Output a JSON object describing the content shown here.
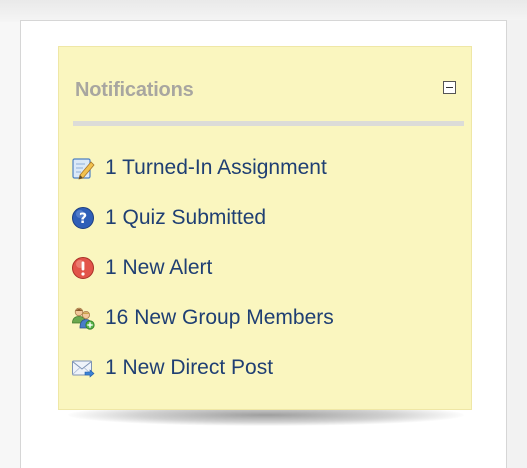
{
  "widget": {
    "title": "Notifications",
    "collapse_icon": "collapse-icon"
  },
  "notifications": [
    {
      "label": "1 Turned-In Assignment",
      "icon": "assignment-pencil-icon"
    },
    {
      "label": "1 Quiz Submitted",
      "icon": "quiz-question-icon"
    },
    {
      "label": "1 New Alert",
      "icon": "alert-icon"
    },
    {
      "label": "16 New Group Members",
      "icon": "group-members-icon"
    },
    {
      "label": "1 New Direct Post",
      "icon": "direct-post-envelope-icon"
    }
  ],
  "colors": {
    "note_background": "#faf6bf",
    "link_text": "#1f3f73",
    "title_text": "#a8a6a0"
  }
}
